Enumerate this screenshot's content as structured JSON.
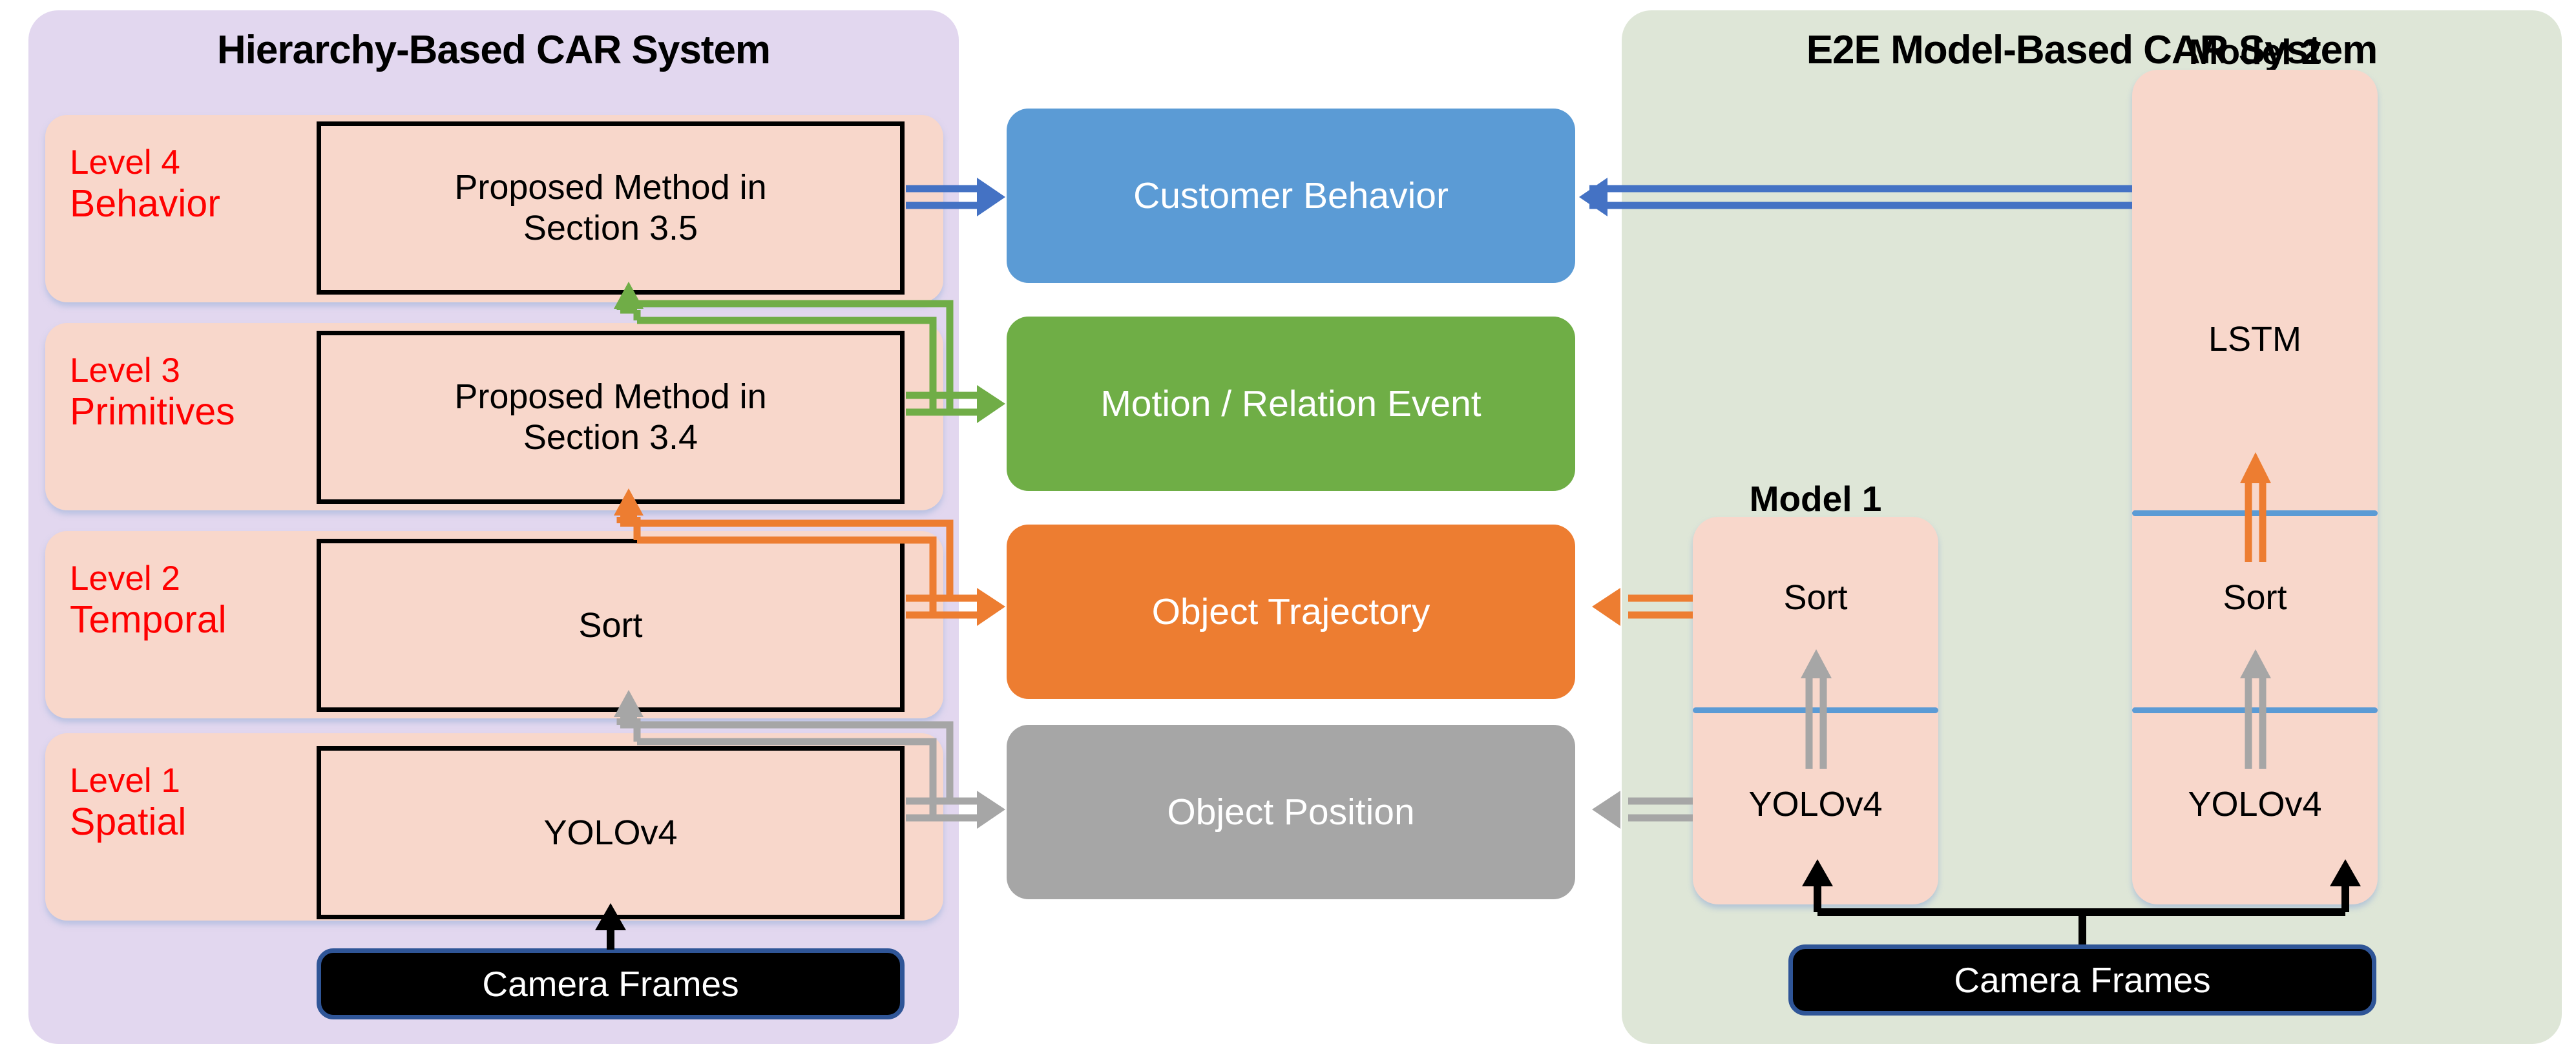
{
  "panels": {
    "left": {
      "title": "Hierarchy-Based CAR System",
      "bg": "#E2D7EF"
    },
    "right": {
      "title": "E2E Model-Based CAR System",
      "bg": "#DEE6D7"
    }
  },
  "levels": [
    {
      "num": "Level 4",
      "name": "Behavior",
      "box": "Proposed Method in Section 3.5",
      "box_l1": "Proposed Method in",
      "box_l2": "Section 3.5"
    },
    {
      "num": "Level 3",
      "name": "Primitives",
      "box": "Proposed Method in Section 3.4",
      "box_l1": "Proposed Method in",
      "box_l2": "Section 3.4"
    },
    {
      "num": "Level 2",
      "name": "Temporal",
      "box": "Sort",
      "box_l1": "Sort",
      "box_l2": ""
    },
    {
      "num": "Level 1",
      "name": "Spatial",
      "box": "YOLOv4",
      "box_l1": "YOLOv4",
      "box_l2": ""
    }
  ],
  "outputs": [
    {
      "label": "Customer Behavior",
      "color": "#5B9BD5"
    },
    {
      "label": "Motion / Relation Event",
      "color": "#6FAE46"
    },
    {
      "label": "Object Trajectory",
      "color": "#ED7D31"
    },
    {
      "label": "Object Position",
      "color": "#A6A6A6"
    }
  ],
  "camera": {
    "left_label": "Camera Frames",
    "right_label": "Camera Frames"
  },
  "models": [
    {
      "title": "Model 1",
      "cells": [
        "Sort",
        "YOLOv4"
      ]
    },
    {
      "title": "Model 2",
      "cells": [
        "LSTM",
        "Sort",
        "YOLOv4"
      ]
    }
  ],
  "colors": {
    "behavior_blue": "#5B9BD5",
    "event_green": "#6FAE46",
    "trajectory_orange": "#ED7D31",
    "position_gray": "#A6A6A6",
    "level_salmon": "#F8D7CB",
    "level_text_red": "#FF0000",
    "panel_purple": "#E2D7EF",
    "panel_green": "#DEE6D7",
    "camera_black": "#000000",
    "camera_border": "#2F5597",
    "arrow_blue": "#4472C4",
    "arrow_green": "#70AD47",
    "arrow_orange": "#ED7D31",
    "arrow_gray": "#A6A6A6",
    "separator_blue": "#5B9BD5"
  }
}
